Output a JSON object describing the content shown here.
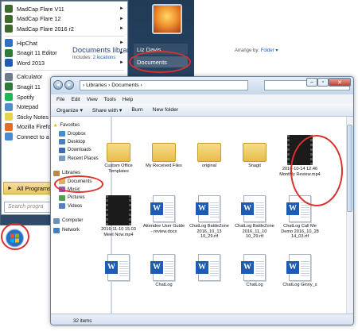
{
  "start_menu": {
    "programs": [
      {
        "label": "MadCap Flare V11",
        "arrow": "►",
        "color": "#3e6a2b"
      },
      {
        "label": "MadCap Flare 12",
        "arrow": "►",
        "color": "#3e6a2b"
      },
      {
        "label": "MadCap Flare 2016 r2",
        "arrow": "►",
        "color": "#3e6a2b"
      },
      {
        "label": "HipChat",
        "arrow": "►",
        "color": "#2f6fc4"
      },
      {
        "label": "Snagit 11 Editor",
        "arrow": "►",
        "color": "#2f7a3a"
      },
      {
        "label": "Word 2013",
        "arrow": "►",
        "color": "#1d5bb5"
      },
      {
        "label": "Calculator",
        "arrow": "",
        "color": "#6d7c8c"
      },
      {
        "label": "Snagit 11",
        "arrow": "",
        "color": "#2f7a3a"
      },
      {
        "label": "Spotify",
        "arrow": "",
        "color": "#1db954"
      },
      {
        "label": "Notepad",
        "arrow": "",
        "color": "#4f8fc9"
      },
      {
        "label": "Sticky Notes",
        "arrow": "",
        "color": "#e8d24a"
      },
      {
        "label": "Mozilla Firefo",
        "arrow": "",
        "color": "#e66a1f"
      },
      {
        "label": "Connect to a",
        "arrow": "",
        "color": "#4a8ad0"
      }
    ],
    "all_programs": "All Programs",
    "search_placeholder": "Search progra",
    "user_name": "Liz Davis",
    "documents": "Documents"
  },
  "explorer": {
    "address": "› Libraries › Documents ›",
    "search_placeholder": "",
    "menu": [
      "File",
      "Edit",
      "View",
      "Tools",
      "Help"
    ],
    "toolbar": {
      "organize": "Organize ▾",
      "share": "Share with ▾",
      "burn": "Burn",
      "new_folder": "New folder"
    },
    "nav": {
      "favorites": "Favorites",
      "favorite_items": [
        "Dropbox",
        "Desktop",
        "Downloads",
        "Recent Places"
      ],
      "libraries": "Libraries",
      "library_items": [
        "Documents",
        "Music",
        "Pictures",
        "Videos"
      ],
      "computer": "Computer",
      "network": "Network"
    },
    "library_title": "Documents library",
    "includes_label": "Includes:",
    "includes_link": "2 locations",
    "arrange_label": "Arrange by:",
    "arrange_value": "Folder ▾",
    "files": [
      {
        "name": "Custom Office Templates",
        "kind": "folder"
      },
      {
        "name": "My Received Files",
        "kind": "folder"
      },
      {
        "name": "original",
        "kind": "folder"
      },
      {
        "name": "Snagit",
        "kind": "folder"
      },
      {
        "name": "2016-10-14 12.46 Monthly Review.mp4",
        "kind": "video"
      },
      {
        "name": "2016-11-10 15.03 Meet Now.mp4",
        "kind": "video"
      },
      {
        "name": "Attendee User Guide - review.docx",
        "kind": "word"
      },
      {
        "name": "ChatLog BattleZone 2016_10_13 10_29.rtf",
        "kind": "word"
      },
      {
        "name": "ChatLog BattleZone 2016_11_10 10_29.rtf",
        "kind": "word"
      },
      {
        "name": "ChatLog Call Me Demo 2016_10_28 14_03.rtf",
        "kind": "word"
      },
      {
        "name": "",
        "kind": "word"
      },
      {
        "name": "ChatLog",
        "kind": "word"
      },
      {
        "name": "",
        "kind": "word"
      },
      {
        "name": "ChatLog",
        "kind": "word"
      },
      {
        "name": "ChatLog Ginny_s",
        "kind": "word"
      }
    ],
    "status": "32 items"
  }
}
